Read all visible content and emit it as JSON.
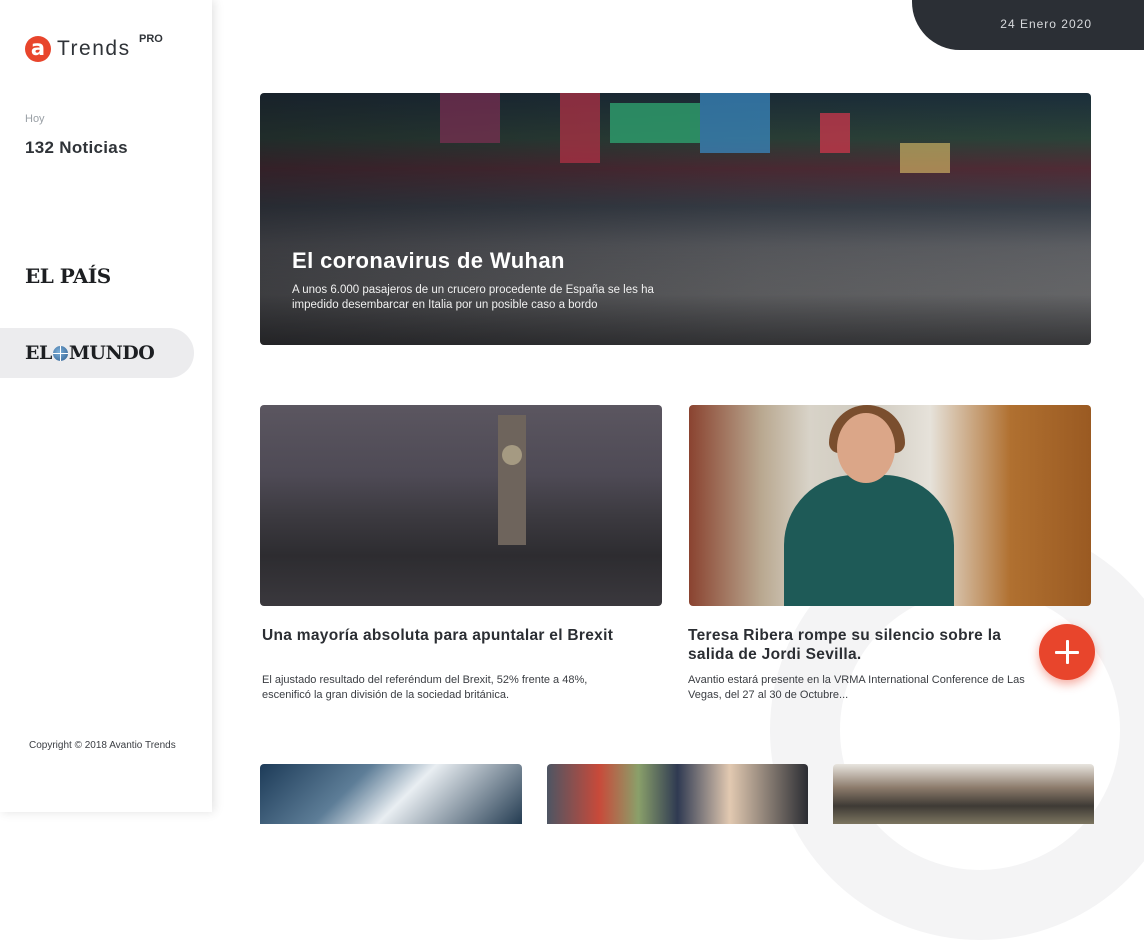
{
  "brand": {
    "logo_glyph": "a",
    "name": "Trends",
    "badge": "PRO",
    "accent": "#e8452c"
  },
  "summary": {
    "label": "Hoy",
    "count": "132 Noticias"
  },
  "sources": [
    {
      "name_part1": "EL PAÍS",
      "selected": false
    },
    {
      "name_part1": "EL",
      "name_part2": "MUNDO",
      "selected": true
    }
  ],
  "footer": {
    "copyright": "Copyright © 2018 Avantio Trends"
  },
  "header": {
    "date": "24 Enero 2020"
  },
  "hero": {
    "title": "El coronavirus de Wuhan",
    "description": "A unos 6.000 pasajeros de un crucero procedente de España se les ha impedido desembarcar en Italia por un posible caso a bordo"
  },
  "cards": [
    {
      "title": "Una mayoría absoluta para apuntalar el Brexit",
      "description": "El ajustado resultado del referéndum del Brexit, 52% frente a 48%, escenificó la gran división de la sociedad británica."
    },
    {
      "title": "Teresa Ribera rompe su silencio sobre la salida de Jordi Sevilla.",
      "description": "Avantio estará presente en la VRMA International Conference de Las Vegas, del 27 al 30 de Octubre..."
    }
  ],
  "fab": {
    "icon": "plus-icon"
  }
}
